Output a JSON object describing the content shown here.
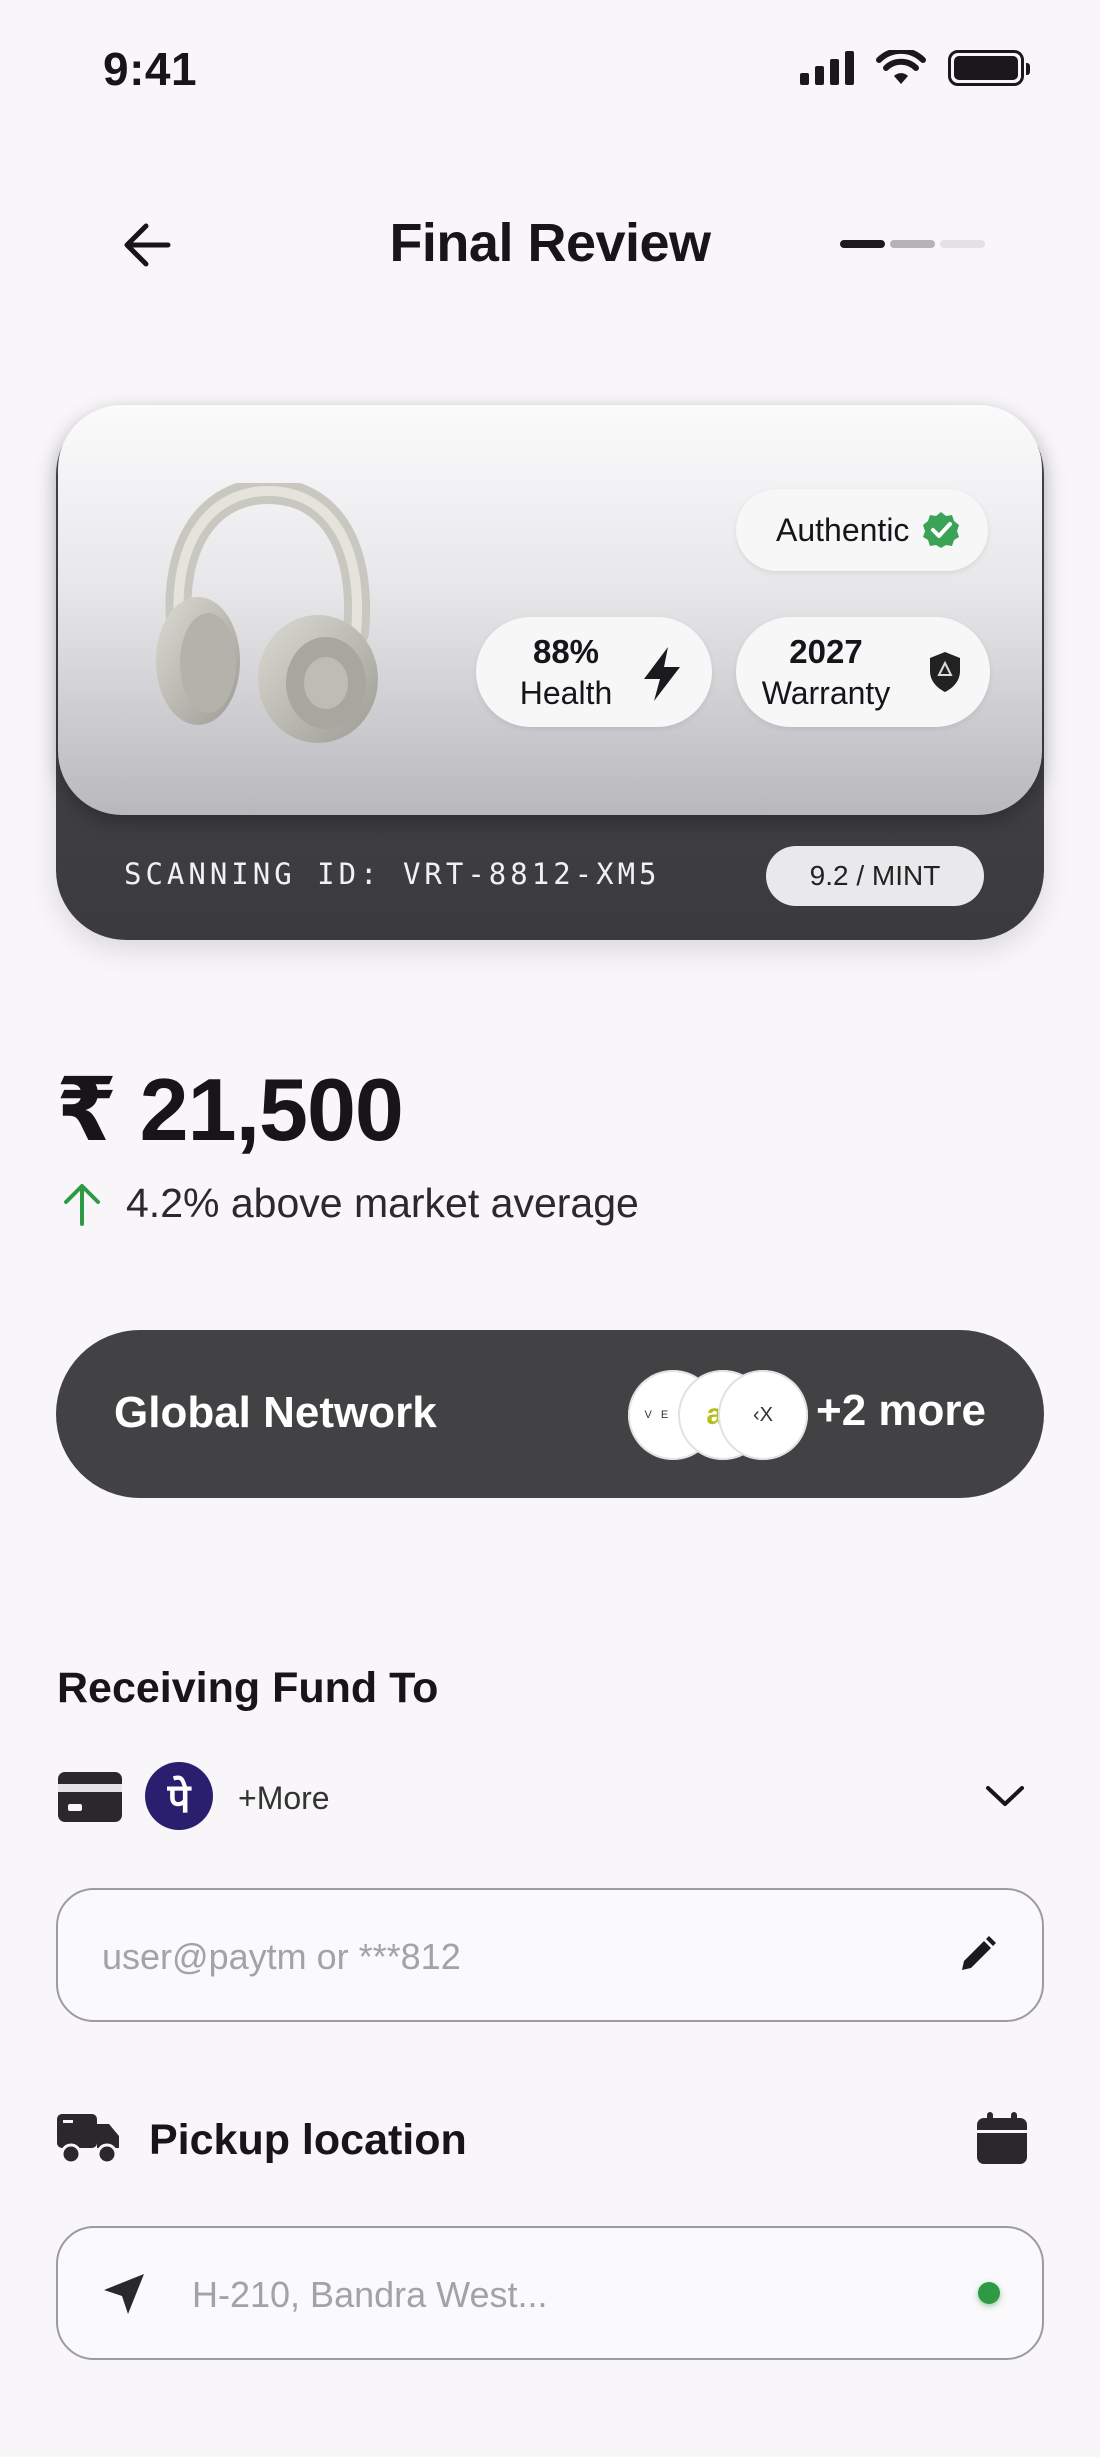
{
  "status_bar": {
    "time": "9:41"
  },
  "header": {
    "title": "Final Review",
    "progress_steps": [
      {
        "state": "done",
        "color": "#1c1a1e"
      },
      {
        "state": "active",
        "color": "#b5b3b8"
      },
      {
        "state": "todo",
        "color": "#e3e1e6"
      }
    ]
  },
  "product": {
    "authentic_label": "Authentic",
    "health_value": "88%",
    "health_label": "Health",
    "warranty_value": "2027",
    "warranty_label": "Warranty",
    "scan_id": "SCANNING ID: VRT-8812-XM5",
    "grade": "9.2 / MINT",
    "image": "headphones-photo"
  },
  "price": {
    "amount": "₹ 21,500",
    "trend_text": "4.2% above market average",
    "trend_color": "#2f9a45"
  },
  "network": {
    "label": "Global Network",
    "logos": [
      "VERA",
      "ay",
      "‹X"
    ],
    "more": "+2 more"
  },
  "fund": {
    "title": "Receiving Fund To",
    "phonepe_glyph": "पे",
    "more_label": "+More",
    "upi_placeholder": "user@paytm or ***812"
  },
  "pickup": {
    "title": "Pickup location",
    "location_placeholder": "H-210, Bandra West...",
    "status_color": "#2f9a45"
  }
}
